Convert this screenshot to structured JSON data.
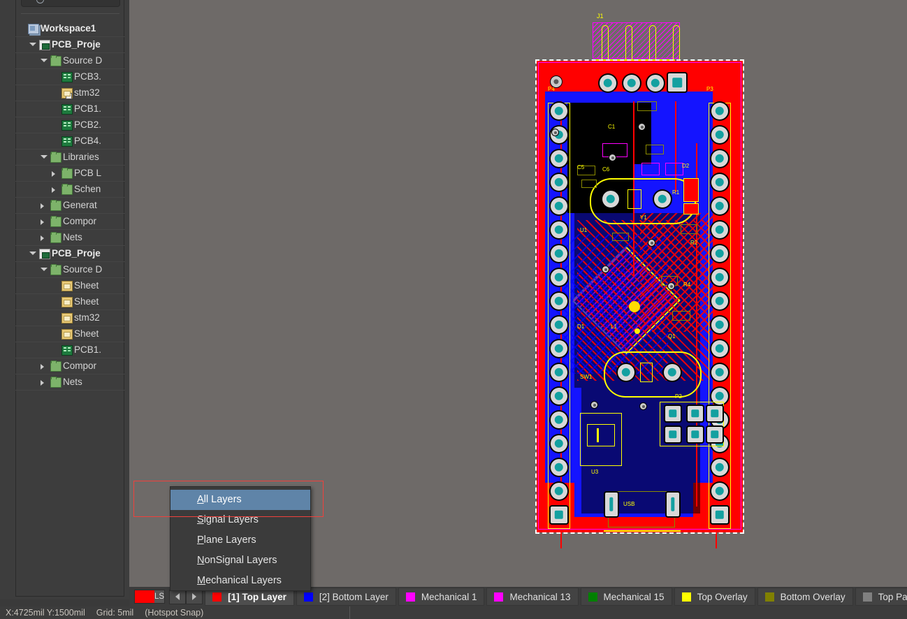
{
  "search": {
    "placeholder": ""
  },
  "projects_panel": {
    "root_label": "Workspace1",
    "tree": [
      {
        "label": "Workspace1",
        "depth": 0,
        "icon": "workspace-icon",
        "state": "none",
        "bold": true,
        "style": "normal"
      },
      {
        "label": "PCB_Proje",
        "depth": 1,
        "icon": "project-icon",
        "state": "open",
        "bold": true,
        "style": "selected"
      },
      {
        "label": "Source D",
        "depth": 2,
        "icon": "folder-icon",
        "state": "open",
        "bold": false,
        "style": "normal"
      },
      {
        "label": "PCB3.",
        "depth": 3,
        "icon": "pcb-doc-icon",
        "state": "none",
        "bold": false,
        "style": "normal"
      },
      {
        "label": "stm32",
        "depth": 3,
        "icon": "sch-sub-icon",
        "state": "none",
        "bold": false,
        "style": "normal"
      },
      {
        "label": "PCB1.",
        "depth": 3,
        "icon": "pcb-doc-icon",
        "state": "none",
        "bold": false,
        "style": "normal"
      },
      {
        "label": "PCB2.",
        "depth": 3,
        "icon": "pcb-doc-icon",
        "state": "none",
        "bold": false,
        "style": "normal"
      },
      {
        "label": "PCB4.",
        "depth": 3,
        "icon": "pcb-doc-icon",
        "state": "none",
        "bold": false,
        "style": "highlight"
      },
      {
        "label": "Libraries",
        "depth": 2,
        "icon": "folder-icon",
        "state": "open",
        "bold": false,
        "style": "normal"
      },
      {
        "label": "PCB L",
        "depth": 3,
        "icon": "folder-icon",
        "state": "closed",
        "bold": false,
        "style": "normal"
      },
      {
        "label": "Schen",
        "depth": 3,
        "icon": "folder-icon",
        "state": "closed",
        "bold": false,
        "style": "normal"
      },
      {
        "label": "Generat",
        "depth": 2,
        "icon": "folder-icon",
        "state": "closed",
        "bold": false,
        "style": "normal"
      },
      {
        "label": "Compor",
        "depth": 2,
        "icon": "folder-icon",
        "state": "closed",
        "bold": false,
        "style": "normal"
      },
      {
        "label": "Nets",
        "depth": 2,
        "icon": "folder-icon",
        "state": "closed",
        "bold": false,
        "style": "normal"
      },
      {
        "label": "PCB_Proje",
        "depth": 1,
        "icon": "project-icon",
        "state": "open",
        "bold": true,
        "style": "normal"
      },
      {
        "label": "Source D",
        "depth": 2,
        "icon": "folder-icon",
        "state": "open",
        "bold": false,
        "style": "normal"
      },
      {
        "label": "Sheet",
        "depth": 3,
        "icon": "sch-doc-icon",
        "state": "none",
        "bold": false,
        "style": "normal"
      },
      {
        "label": "Sheet",
        "depth": 3,
        "icon": "sch-doc-icon",
        "state": "none",
        "bold": false,
        "style": "normal"
      },
      {
        "label": "stm32",
        "depth": 3,
        "icon": "sch-doc-icon",
        "state": "none",
        "bold": false,
        "style": "normal"
      },
      {
        "label": "Sheet",
        "depth": 3,
        "icon": "sch-doc-icon",
        "state": "none",
        "bold": false,
        "style": "normal"
      },
      {
        "label": "PCB1.",
        "depth": 3,
        "icon": "pcb-doc-icon",
        "state": "none",
        "bold": false,
        "style": "normal"
      },
      {
        "label": "Compor",
        "depth": 2,
        "icon": "folder-icon",
        "state": "closed",
        "bold": false,
        "style": "normal"
      },
      {
        "label": "Nets",
        "depth": 2,
        "icon": "folder-icon",
        "state": "closed",
        "bold": false,
        "style": "normal"
      }
    ]
  },
  "context_menu": {
    "items": [
      {
        "label": "All Layers",
        "accel": "A",
        "selected": true
      },
      {
        "label": "Signal Layers",
        "accel": "S",
        "selected": false
      },
      {
        "label": "Plane Layers",
        "accel": "P",
        "selected": false
      },
      {
        "label": "NonSignal Layers",
        "accel": "N",
        "selected": false
      },
      {
        "label": "Mechanical Layers",
        "accel": "M",
        "selected": false
      }
    ],
    "highlight_color": "#f0413c"
  },
  "layer_bar": {
    "ls_button": {
      "label": "LS",
      "color": "#ff0000"
    },
    "prev_label": "previous-layer",
    "next_label": "next-layer",
    "tabs": [
      {
        "label": "[1] Top Layer",
        "color": "#ff0000",
        "active": true
      },
      {
        "label": "[2] Bottom Layer",
        "color": "#0000ff",
        "active": false
      },
      {
        "label": "Mechanical 1",
        "color": "#ff00ff",
        "active": false
      },
      {
        "label": "Mechanical 13",
        "color": "#ff00ff",
        "active": false
      },
      {
        "label": "Mechanical 15",
        "color": "#008000",
        "active": false
      },
      {
        "label": "Top Overlay",
        "color": "#ffff00",
        "active": false
      },
      {
        "label": "Bottom Overlay",
        "color": "#808000",
        "active": false
      },
      {
        "label": "Top Paste",
        "color": "#808080",
        "active": false
      }
    ]
  },
  "status_bar": {
    "coordinates": "X:4725mil Y:1500mil",
    "grid": "Grid: 5mil",
    "snap": "(Hotspot Snap)"
  },
  "pcb": {
    "designators": [
      "P4",
      "P3",
      "P2",
      "U3",
      "U1",
      "SW1",
      "USB",
      "C5",
      "C6",
      "D2",
      "R1",
      "R2",
      "Q1",
      "J1",
      "L1",
      "Y1",
      "D1",
      "R4",
      "C1"
    ],
    "board_outline_color": "#ffffff",
    "top_copper_color": "#ff0000",
    "bottom_copper_color": "#0000ff",
    "overlay_color": "#ffff00",
    "keepout_color": "#ff00ff"
  }
}
